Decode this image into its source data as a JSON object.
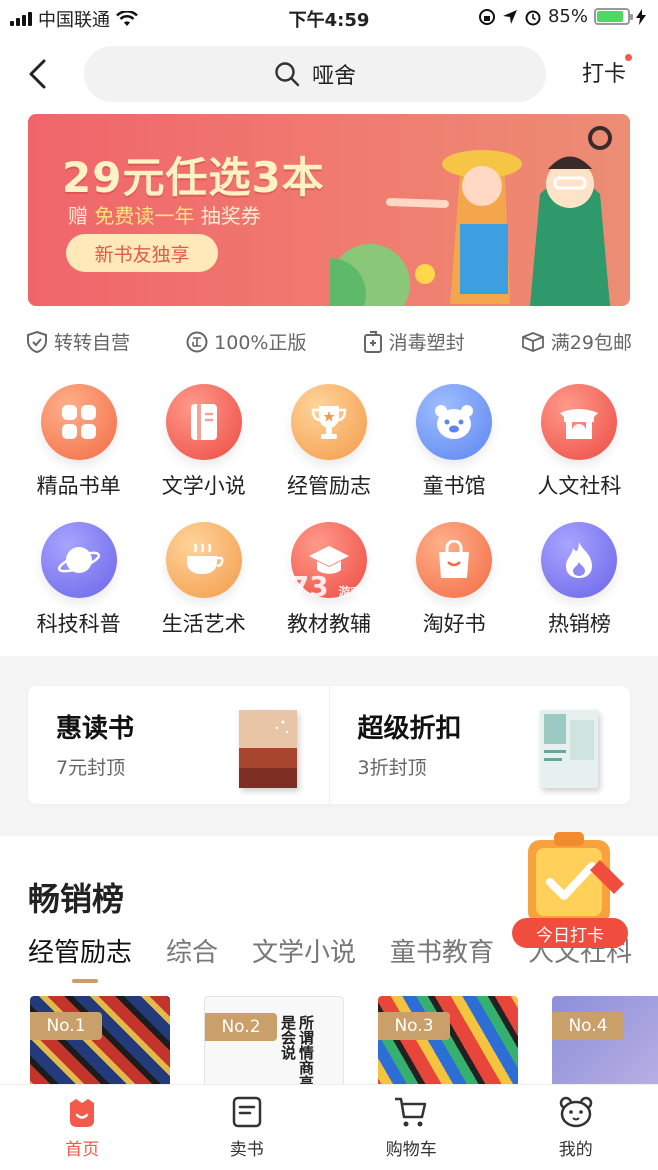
{
  "status_bar": {
    "carrier": "中国联通",
    "time": "下午4:59",
    "battery_percent": "85%",
    "battery_level": 0.85
  },
  "nav": {
    "search_query": "哑舍",
    "checkin_label": "打卡"
  },
  "banner": {
    "title": "29元任选3本",
    "subtitle_prefix": "赠",
    "subtitle_highlight": "免费读一年",
    "subtitle_suffix": "抽奖券",
    "button_label": "新书友独享"
  },
  "guarantees": [
    {
      "icon": "shield-check-icon",
      "label": "转转自营"
    },
    {
      "icon": "genuine-icon",
      "label": "100%正版"
    },
    {
      "icon": "sealed-package-icon",
      "label": "消毒塑封"
    },
    {
      "icon": "box-icon",
      "label": "满29包邮"
    }
  ],
  "categories": [
    {
      "icon": "grid-icon",
      "label": "精品书单",
      "color": "#f26b45"
    },
    {
      "icon": "book-icon",
      "label": "文学小说",
      "color": "#ec4a42"
    },
    {
      "icon": "trophy-icon",
      "label": "经管励志",
      "color": "#f39a4a"
    },
    {
      "icon": "bear-icon",
      "label": "童书馆",
      "color": "#5b86f0"
    },
    {
      "icon": "pavilion-icon",
      "label": "人文社科",
      "color": "#ec4a42"
    },
    {
      "icon": "planet-icon",
      "label": "科技科普",
      "color": "#6a64e8"
    },
    {
      "icon": "coffee-icon",
      "label": "生活艺术",
      "color": "#f39a4a"
    },
    {
      "icon": "graduation-cap-icon",
      "label": "教材教辅",
      "color": "#ec4a42"
    },
    {
      "icon": "shopping-bag-icon",
      "label": "淘好书",
      "color": "#f26b45"
    },
    {
      "icon": "fire-icon",
      "label": "热销榜",
      "color": "#6a64e8"
    }
  ],
  "deals": [
    {
      "title": "惠读书",
      "subtitle": "7元封顶"
    },
    {
      "title": "超级折扣",
      "subtitle": "3折封顶"
    }
  ],
  "bestseller": {
    "heading": "畅销榜",
    "tabs": [
      "经管励志",
      "综合",
      "文学小说",
      "童书教育",
      "人文社科"
    ],
    "active_tab": 0,
    "books": [
      {
        "rank": "No.1"
      },
      {
        "rank": "No.2",
        "cover_text": "所谓情商高就是会说"
      },
      {
        "rank": "No.3"
      },
      {
        "rank": "No.4"
      }
    ]
  },
  "floating_checkin": {
    "label": "今日打卡"
  },
  "watermark": {
    "text": "K73",
    "sub": "游戏之家 .com"
  },
  "tabbar": [
    {
      "icon": "home-face-icon",
      "label": "首页",
      "active": true
    },
    {
      "icon": "sell-book-icon",
      "label": "卖书",
      "active": false
    },
    {
      "icon": "cart-icon",
      "label": "购物车",
      "active": false
    },
    {
      "icon": "profile-bear-icon",
      "label": "我的",
      "active": false
    }
  ],
  "colors": {
    "accent": "#f25a4b",
    "gold": "#c9a06a"
  }
}
